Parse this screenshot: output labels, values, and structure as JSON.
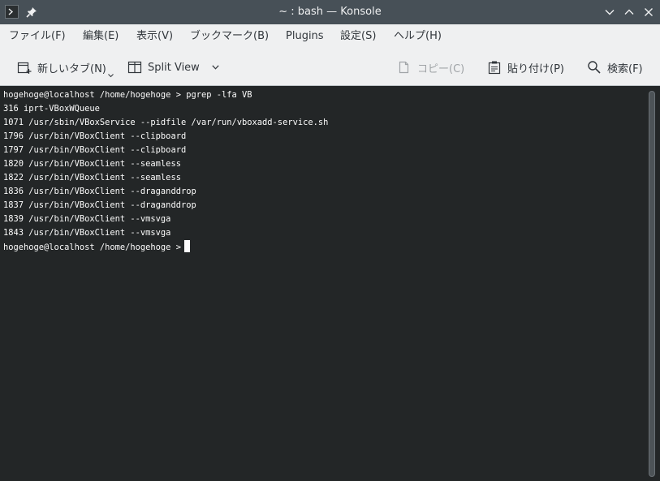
{
  "window": {
    "title": "~ : bash — Konsole"
  },
  "icons": {
    "app": "konsole-terminal-icon",
    "pin": "pin-icon",
    "minimize": "chevron-down-icon",
    "maximize": "chevron-up-icon",
    "close": "close-icon",
    "new_tab": "new-tab-icon",
    "split_view": "split-view-icon",
    "copy": "copy-icon",
    "paste": "paste-icon",
    "find": "search-icon"
  },
  "menubar": {
    "file": "ファイル(F)",
    "edit": "編集(E)",
    "view": "表示(V)",
    "bookmarks": "ブックマーク(B)",
    "plugins": "Plugins",
    "settings": "設定(S)",
    "help": "ヘルプ(H)"
  },
  "toolbar": {
    "new_tab": "新しいタブ(N)",
    "split_view": "Split View",
    "copy": "コピー(C)",
    "paste": "貼り付け(P)",
    "find": "検索(F)"
  },
  "terminal": {
    "lines": [
      "hogehoge@localhost /home/hogehoge > pgrep -lfa VB",
      "316 iprt-VBoxWQueue",
      "1071 /usr/sbin/VBoxService --pidfile /var/run/vboxadd-service.sh",
      "1796 /usr/bin/VBoxClient --clipboard",
      "1797 /usr/bin/VBoxClient --clipboard",
      "1820 /usr/bin/VBoxClient --seamless",
      "1822 /usr/bin/VBoxClient --seamless",
      "1836 /usr/bin/VBoxClient --draganddrop",
      "1837 /usr/bin/VBoxClient --draganddrop",
      "1839 /usr/bin/VBoxClient --vmsvga",
      "1843 /usr/bin/VBoxClient --vmsvga"
    ],
    "prompt": "hogehoge@localhost /home/hogehoge >"
  }
}
